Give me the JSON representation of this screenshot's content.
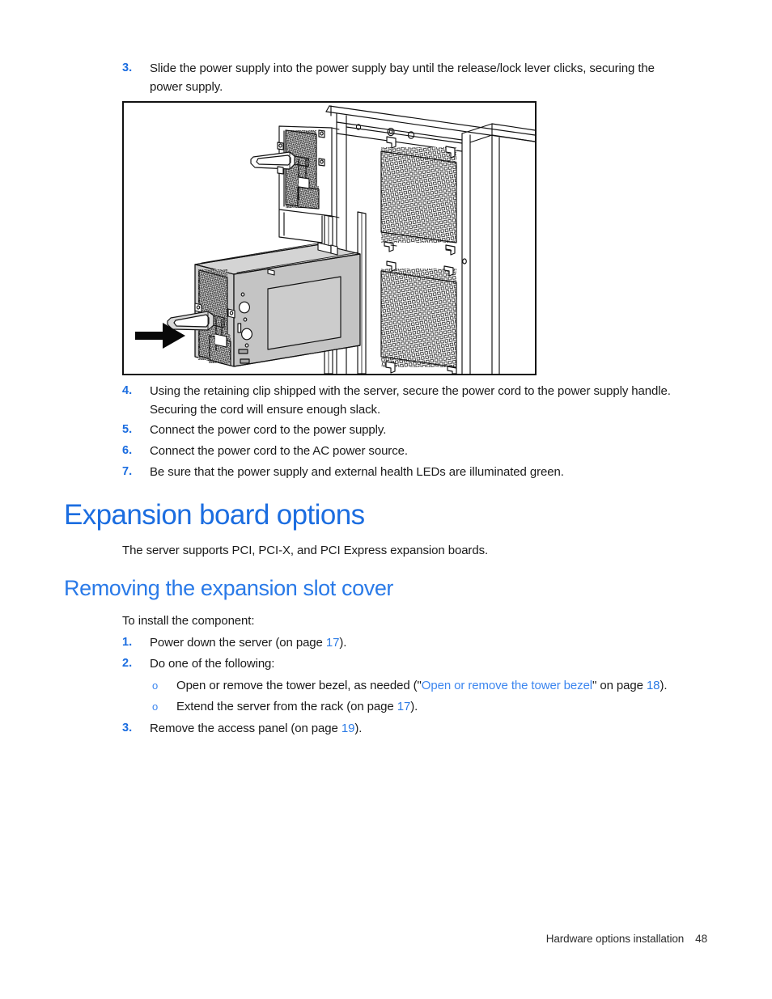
{
  "document": {
    "footer": {
      "title": "Hardware options installation",
      "page_number": "48"
    }
  },
  "steps_top": {
    "step3": {
      "marker": "3.",
      "text": "Slide the power supply into the power supply bay until the release/lock lever clicks, securing the power supply."
    }
  },
  "figure": {
    "caption": "",
    "alt_name": "power-supply-installation-diagram"
  },
  "steps_bottom": [
    {
      "marker": "4.",
      "text": "Using the retaining clip shipped with the server, secure the power cord to the power supply handle. Securing the cord will ensure enough slack."
    },
    {
      "marker": "5.",
      "text": "Connect the power cord to the power supply."
    },
    {
      "marker": "6.",
      "text": "Connect the power cord to the AC power source."
    },
    {
      "marker": "7.",
      "text": "Be sure that the power supply and external health LEDs are illuminated green."
    }
  ],
  "section": {
    "heading": "Expansion board options",
    "intro": "The server supports PCI, PCI-X, and PCI Express expansion boards."
  },
  "subsection": {
    "heading": "Removing the expansion slot cover",
    "intro": "To install the component:",
    "steps": {
      "s1": {
        "marker": "1.",
        "prefix": "Power down the server (on page ",
        "link": "17",
        "suffix": ")."
      },
      "s2": {
        "marker": "2.",
        "text": "Do one of the following:"
      },
      "s2a": {
        "bullet": "o",
        "prefix": "Open or remove the tower bezel, as needed (\"",
        "link_title": "Open or remove the tower bezel",
        "mid": "\" on page ",
        "link_page": "18",
        "suffix": ")."
      },
      "s2b": {
        "bullet": "o",
        "prefix": "Extend the server from the rack (on page ",
        "link_page": "17",
        "suffix": ")."
      },
      "s3": {
        "marker": "3.",
        "prefix": "Remove the access panel (on page ",
        "link_page": "19",
        "suffix": ")."
      }
    }
  },
  "colors": {
    "heading_blue": "#1b6de0",
    "subheading_blue": "#2a7ae8",
    "link_blue": "#2c7be5",
    "marker_blue": "#1b6de0",
    "text_black": "#1a1a1a",
    "figure_border": "#111111"
  }
}
